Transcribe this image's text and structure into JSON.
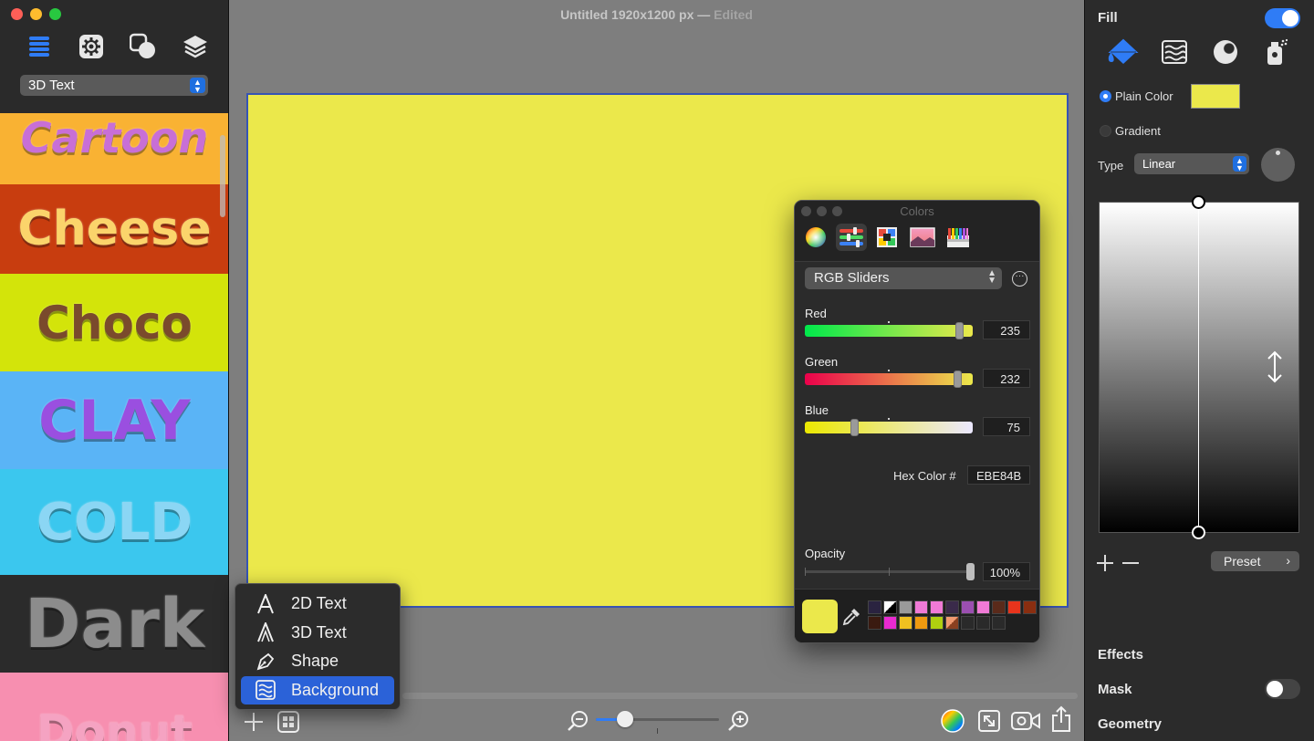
{
  "window": {
    "title": "Untitled 1920x1200 px",
    "separator": "—",
    "status": "Edited"
  },
  "sidebar": {
    "tool_icons": [
      "list-icon",
      "gear-icon",
      "shapes-icon",
      "layers-icon"
    ],
    "category": "3D Text",
    "styles": [
      {
        "label": "Cartoon",
        "bg": "#f9b233",
        "fg": "#c86fd6"
      },
      {
        "label": "Cheese",
        "bg": "#c83d0f",
        "fg": "#fbd46b"
      },
      {
        "label": "Choco",
        "bg": "#d3e40a",
        "fg": "#7a4a2c"
      },
      {
        "label": "CLAY",
        "bg": "#5ab4f6",
        "fg": "#9a4fe0"
      },
      {
        "label": "COLD",
        "bg": "#3bc7ee",
        "fg": "#8bd6f4"
      },
      {
        "label": "Dark",
        "bg": "#2b2b2b",
        "fg": "#8c8c8c"
      },
      {
        "label": "Donut",
        "bg": "#f78fb0",
        "fg": "#f5a3c2"
      }
    ]
  },
  "canvas": {
    "fill_color": "#EBE84B"
  },
  "add_menu": {
    "items": [
      {
        "label": "2D Text",
        "icon": "text-2d-icon",
        "active": false
      },
      {
        "label": "3D Text",
        "icon": "text-3d-icon",
        "active": false
      },
      {
        "label": "Shape",
        "icon": "pen-icon",
        "active": false
      },
      {
        "label": "Background",
        "icon": "background-icon",
        "active": true
      }
    ]
  },
  "colors_panel": {
    "title": "Colors",
    "tabs": [
      "color-wheel-icon",
      "sliders-icon",
      "palettes-icon",
      "image-palette-icon",
      "crayons-icon"
    ],
    "mode": "RGB Sliders",
    "channels": [
      {
        "label": "Red",
        "value": "235",
        "fraction": 0.922
      },
      {
        "label": "Green",
        "value": "232",
        "fraction": 0.91
      },
      {
        "label": "Blue",
        "value": "75",
        "fraction": 0.294
      }
    ],
    "hex_label": "Hex Color #",
    "hex_value": "EBE84B",
    "opacity_label": "Opacity",
    "opacity_value": "100%",
    "swatches": [
      "#2a2340",
      "split",
      "#9a9a9a",
      "#f07ad6",
      "#f07ad6",
      "#3a2a4a",
      "#9b4fb0",
      "#f07ad6",
      "#5a2a1a",
      "#e8341c",
      "#8a2e10",
      "#3a1a10",
      "#e82ad0",
      "#f0c020",
      "#f09a10",
      "#b0d010",
      "split2",
      "#2a2a2a",
      "#2a2a2a",
      "#2a2a2a"
    ]
  },
  "inspector": {
    "fill_title": "Fill",
    "fill_enabled": true,
    "fill_tabs": [
      "paint-bucket-icon",
      "texture-icon",
      "radial-icon",
      "spray-icon"
    ],
    "plain_color_label": "Plain Color",
    "plain_color": "#EBE84B",
    "gradient_label": "Gradient",
    "type_label": "Type",
    "type_value": "Linear",
    "preset_label": "Preset",
    "effects_title": "Effects",
    "mask_title": "Mask",
    "mask_enabled": false,
    "geometry_title": "Geometry"
  },
  "zoom": {
    "fraction": 0.18
  }
}
